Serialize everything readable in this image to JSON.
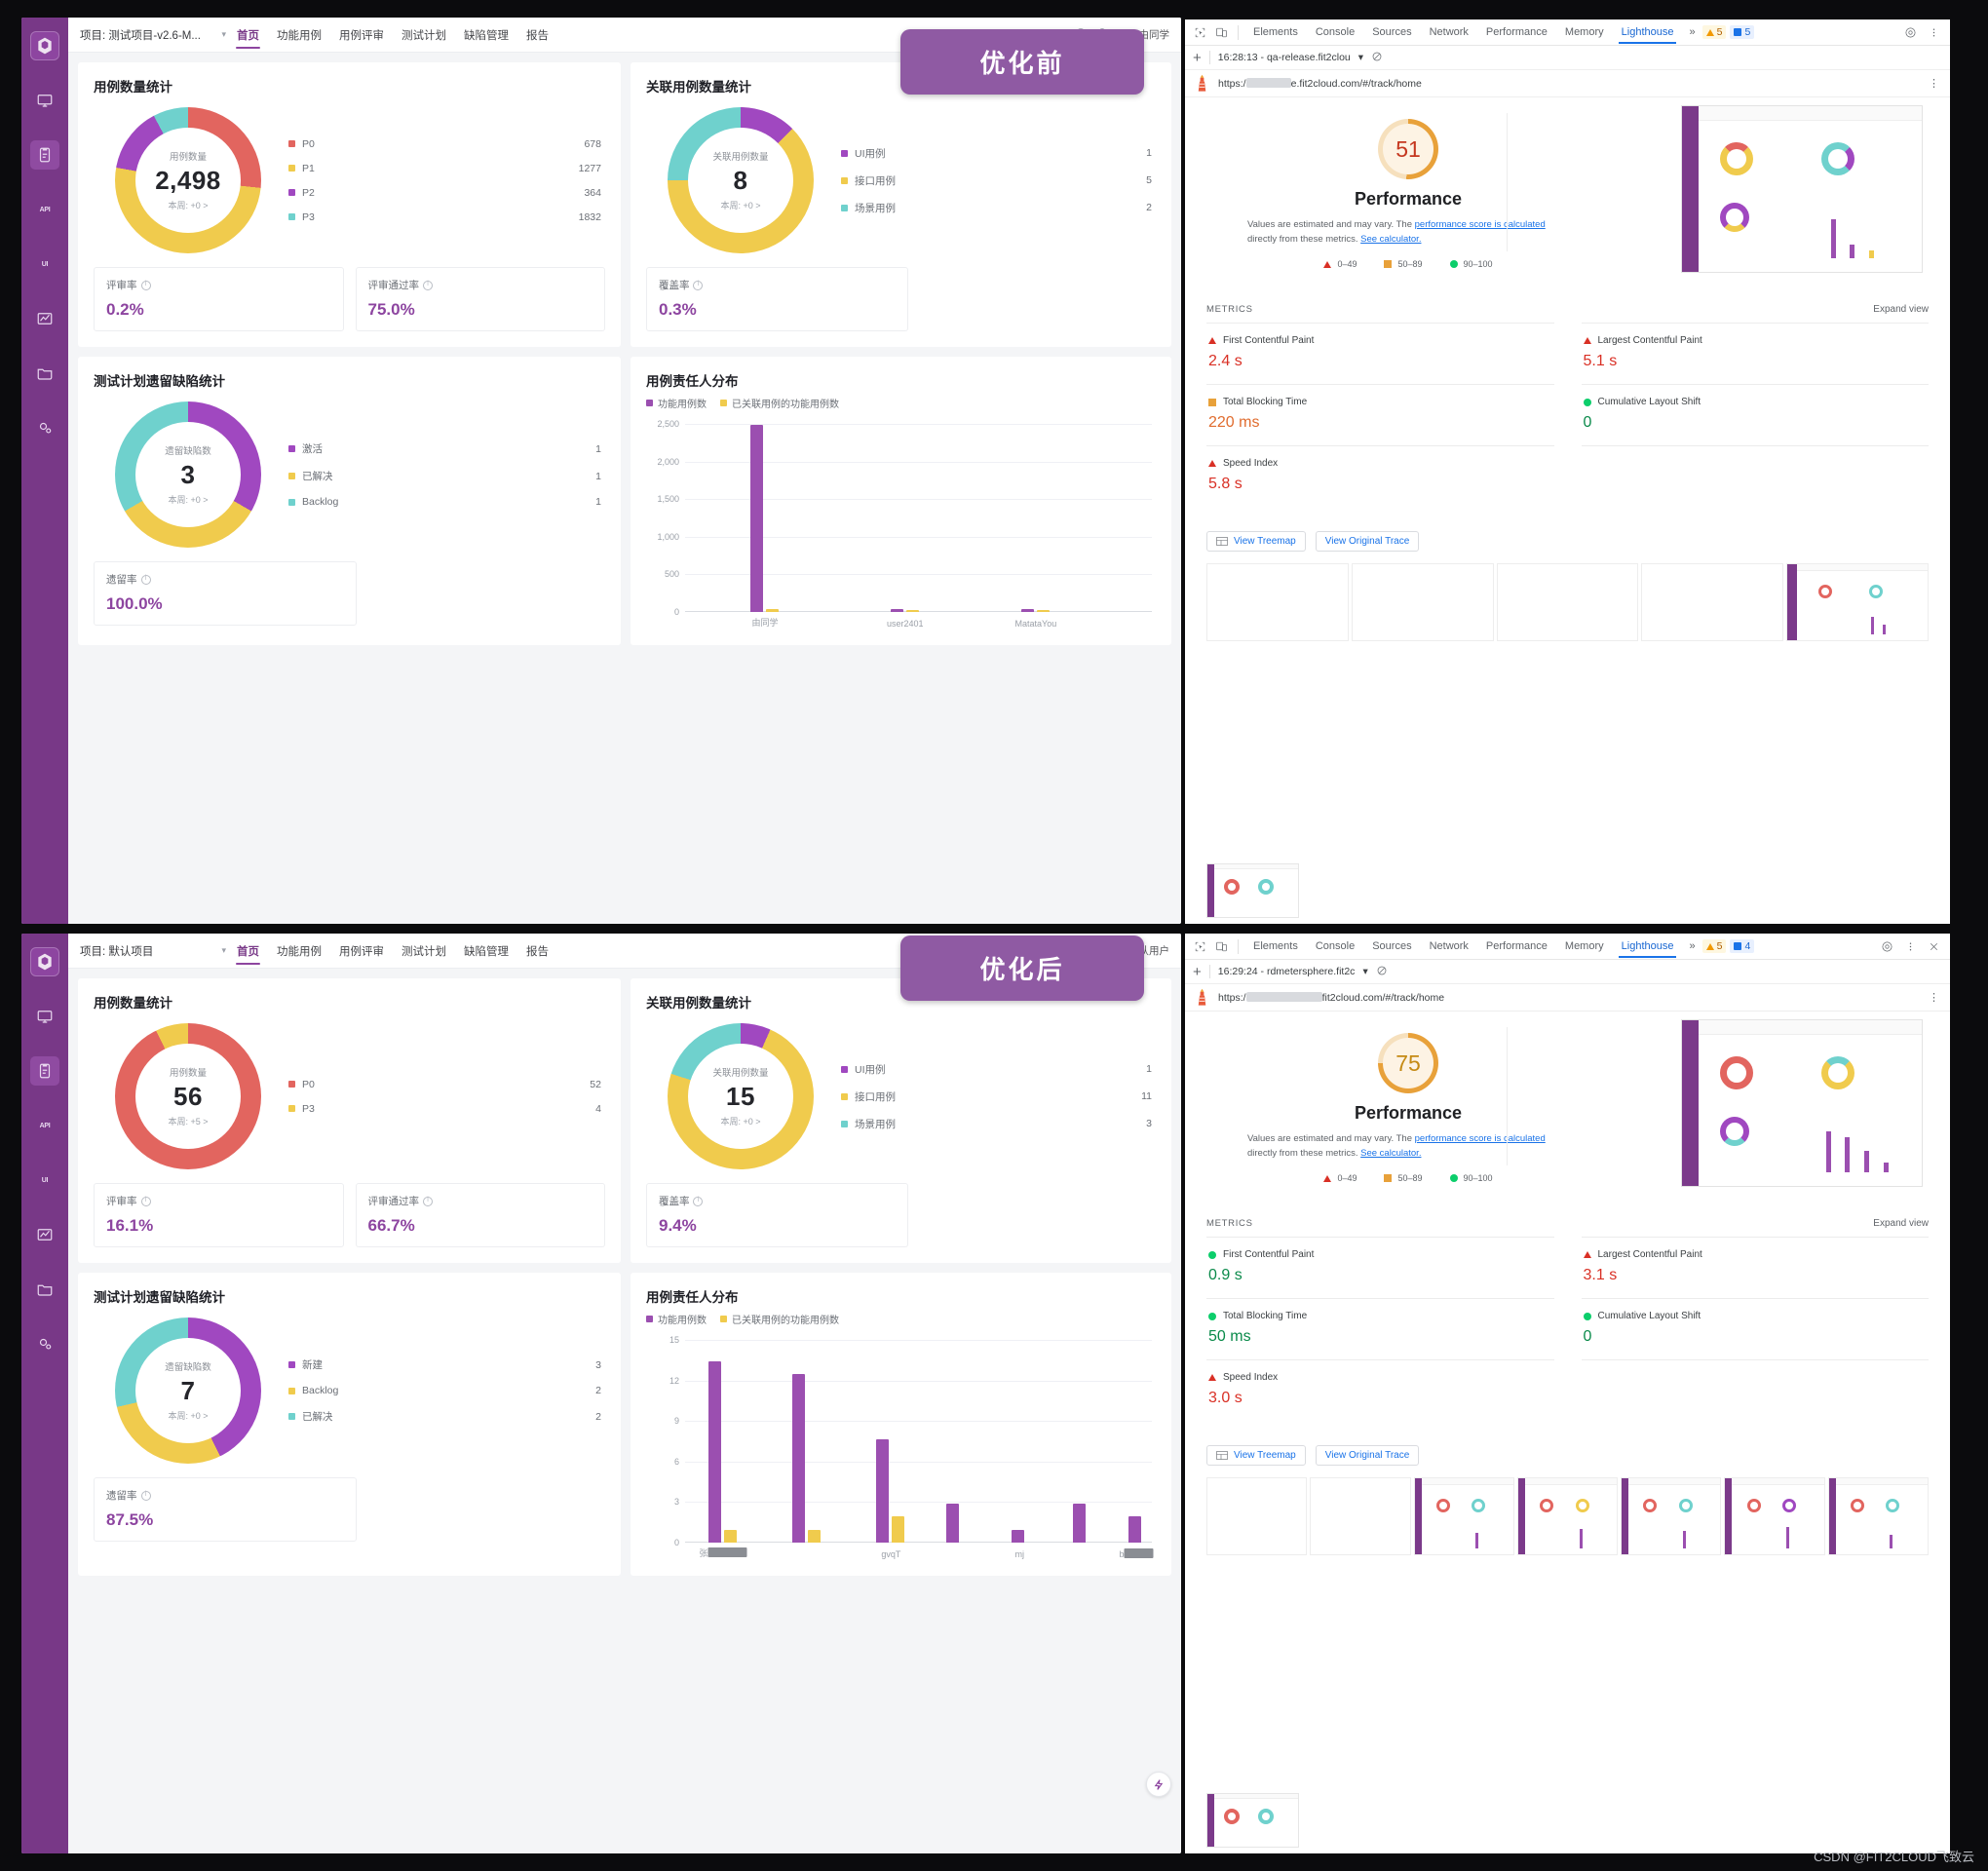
{
  "overlay": {
    "tag_before": "优化前",
    "tag_after": "优化后",
    "watermark": "CSDN @FIT2CLOUD飞致云"
  },
  "app_top": {
    "project_selector": "项目: 测试项目-v2.6-M...",
    "nav": [
      "首页",
      "功能用例",
      "用例评审",
      "测试计划",
      "缺陷管理",
      "报告"
    ],
    "active_nav": "首页",
    "user": "由同学",
    "cards": {
      "case_count": {
        "title": "用例数量统计",
        "center_label": "用例数量",
        "center_value": "2,498",
        "center_sub": "本周: +0 >",
        "legend": [
          {
            "label": "P0",
            "value": "678",
            "color": "#e2655f"
          },
          {
            "label": "P1",
            "value": "1277",
            "color": "#f0cb4d"
          },
          {
            "label": "P2",
            "value": "364",
            "color": "#a048c0"
          },
          {
            "label": "P3",
            "value": "1832",
            "color": "#6fd1cd"
          }
        ],
        "stats": [
          {
            "label": "评审率",
            "value": "0.2%"
          },
          {
            "label": "评审通过率",
            "value": "75.0%"
          }
        ]
      },
      "linked_case_count": {
        "title": "关联用例数量统计",
        "center_label": "关联用例数量",
        "center_value": "8",
        "center_sub": "本周: +0 >",
        "legend": [
          {
            "label": "UI用例",
            "value": "1",
            "color": "#a048c0"
          },
          {
            "label": "接口用例",
            "value": "5",
            "color": "#f0cb4d"
          },
          {
            "label": "场景用例",
            "value": "2",
            "color": "#6fd1cd"
          }
        ],
        "stats": [
          {
            "label": "覆盖率",
            "value": "0.3%"
          }
        ]
      },
      "plan_defects": {
        "title": "测试计划遗留缺陷统计",
        "center_label": "遗留缺陷数",
        "center_value": "3",
        "center_sub": "本周: +0 >",
        "legend": [
          {
            "label": "激活",
            "value": "1",
            "color": "#a048c0"
          },
          {
            "label": "已解决",
            "value": "1",
            "color": "#f0cb4d"
          },
          {
            "label": "Backlog",
            "value": "1",
            "color": "#6fd1cd"
          }
        ],
        "stats": [
          {
            "label": "遗留率",
            "value": "100.0%"
          }
        ]
      },
      "owner_dist": {
        "title": "用例责任人分布",
        "legend": [
          {
            "label": "功能用例数",
            "color": "#9b4fb0"
          },
          {
            "label": "已关联用例的功能用例数",
            "color": "#f0cb4d"
          }
        ]
      }
    }
  },
  "app_bottom": {
    "project_selector": "项目: 默认项目",
    "nav": [
      "首页",
      "功能用例",
      "用例评审",
      "测试计划",
      "缺陷管理",
      "报告"
    ],
    "active_nav": "首页",
    "user": "默认用户",
    "cards": {
      "case_count": {
        "title": "用例数量统计",
        "center_label": "用例数量",
        "center_value": "56",
        "center_sub": "本周: +5 >",
        "legend": [
          {
            "label": "P0",
            "value": "52",
            "color": "#e2655f"
          },
          {
            "label": "P3",
            "value": "4",
            "color": "#f0cb4d"
          }
        ],
        "stats": [
          {
            "label": "评审率",
            "value": "16.1%"
          },
          {
            "label": "评审通过率",
            "value": "66.7%"
          }
        ]
      },
      "linked_case_count": {
        "title": "关联用例数量统计",
        "center_label": "关联用例数量",
        "center_value": "15",
        "center_sub": "本周: +0 >",
        "legend": [
          {
            "label": "UI用例",
            "value": "1",
            "color": "#a048c0"
          },
          {
            "label": "接口用例",
            "value": "11",
            "color": "#f0cb4d"
          },
          {
            "label": "场景用例",
            "value": "3",
            "color": "#6fd1cd"
          }
        ],
        "stats": [
          {
            "label": "覆盖率",
            "value": "9.4%"
          }
        ]
      },
      "plan_defects": {
        "title": "测试计划遗留缺陷统计",
        "center_label": "遗留缺陷数",
        "center_value": "7",
        "center_sub": "本周: +0 >",
        "legend": [
          {
            "label": "新建",
            "value": "3",
            "color": "#a048c0"
          },
          {
            "label": "Backlog",
            "value": "2",
            "color": "#f0cb4d"
          },
          {
            "label": "已解决",
            "value": "2",
            "color": "#6fd1cd"
          }
        ],
        "stats": [
          {
            "label": "遗留率",
            "value": "87.5%"
          }
        ]
      },
      "owner_dist": {
        "title": "用例责任人分布",
        "legend": [
          {
            "label": "功能用例数",
            "color": "#9b4fb0"
          },
          {
            "label": "已关联用例的功能用例数",
            "color": "#f0cb4d"
          }
        ]
      }
    }
  },
  "devtools_top": {
    "tabs": [
      "Elements",
      "Console",
      "Sources",
      "Network",
      "Performance",
      "Memory",
      "Lighthouse"
    ],
    "active_tab": "Lighthouse",
    "overflow": "»",
    "warn_count": "5",
    "info_count": "5",
    "run_timestamp": "16:28:13 - qa-release.fit2clou",
    "url": "https://□□□□□e.fit2cloud.com/#/track/home"
  },
  "devtools_bottom": {
    "tabs": [
      "Elements",
      "Console",
      "Sources",
      "Network",
      "Performance",
      "Memory",
      "Lighthouse"
    ],
    "active_tab": "Lighthouse",
    "overflow": "»",
    "warn_count": "5",
    "info_count": "4",
    "run_timestamp": "16:29:24 - rdmetersphere.fit2c",
    "url": "https://□□□□□□fit2cloud.com/#/track/home"
  },
  "lighthouse_top": {
    "score": "51",
    "score_color": "#c5371f",
    "gauge_color": "#e8a13a",
    "gauge_bg": "#fdf3e4",
    "category": "Performance",
    "note_1": "Values are estimated and may vary. The ",
    "note_link_1": "performance score is calculated",
    "note_2": " directly from these metrics. ",
    "note_link_2": "See calculator.",
    "scale": [
      "0–49",
      "50–89",
      "90–100"
    ],
    "metrics_header": "METRICS",
    "expand_view": "Expand view",
    "metrics": [
      {
        "label": "First Contentful Paint",
        "value": "2.4 s",
        "status": "bad"
      },
      {
        "label": "Largest Contentful Paint",
        "value": "5.1 s",
        "status": "bad"
      },
      {
        "label": "Total Blocking Time",
        "value": "220 ms",
        "status": "avg"
      },
      {
        "label": "Cumulative Layout Shift",
        "value": "0",
        "status": "good"
      },
      {
        "label": "Speed Index",
        "value": "5.8 s",
        "status": "bad"
      }
    ],
    "buttons": [
      "View Treemap",
      "View Original Trace"
    ]
  },
  "lighthouse_bottom": {
    "score": "75",
    "score_color": "#c58a14",
    "gauge_color": "#e8a13a",
    "gauge_bg": "#fdf3e4",
    "category": "Performance",
    "note_1": "Values are estimated and may vary. The ",
    "note_link_1": "performance score is calculated",
    "note_2": " directly from these metrics. ",
    "note_link_2": "See calculator.",
    "scale": [
      "0–49",
      "50–89",
      "90–100"
    ],
    "metrics_header": "METRICS",
    "expand_view": "Expand view",
    "metrics": [
      {
        "label": "First Contentful Paint",
        "value": "0.9 s",
        "status": "good"
      },
      {
        "label": "Largest Contentful Paint",
        "value": "3.1 s",
        "status": "bad"
      },
      {
        "label": "Total Blocking Time",
        "value": "50 ms",
        "status": "good"
      },
      {
        "label": "Cumulative Layout Shift",
        "value": "0",
        "status": "good"
      },
      {
        "label": "Speed Index",
        "value": "3.0 s",
        "status": "bad"
      }
    ],
    "buttons": [
      "View Treemap",
      "View Original Trace"
    ]
  },
  "chart_data": [
    {
      "id": "top_case_count_donut",
      "type": "pie",
      "title": "用例数量统计",
      "categories": [
        "P0",
        "P1",
        "P2",
        "P3"
      ],
      "values": [
        678,
        1277,
        364,
        1832
      ],
      "colors": [
        "#e2655f",
        "#f0cb4d",
        "#a048c0",
        "#6fd1cd"
      ],
      "center_total": 2498,
      "legend": "right"
    },
    {
      "id": "top_linked_donut",
      "type": "pie",
      "title": "关联用例数量统计",
      "categories": [
        "UI用例",
        "接口用例",
        "场景用例"
      ],
      "values": [
        1,
        5,
        2
      ],
      "colors": [
        "#a048c0",
        "#f0cb4d",
        "#6fd1cd"
      ],
      "center_total": 8,
      "legend": "right"
    },
    {
      "id": "top_plan_defect_donut",
      "type": "pie",
      "title": "测试计划遗留缺陷统计",
      "categories": [
        "激活",
        "已解决",
        "Backlog"
      ],
      "values": [
        1,
        1,
        1
      ],
      "colors": [
        "#a048c0",
        "#f0cb4d",
        "#6fd1cd"
      ],
      "center_total": 3,
      "legend": "right"
    },
    {
      "id": "top_owner_bar",
      "type": "bar",
      "title": "用例责任人分布",
      "categories": [
        "由同学",
        "user2401",
        "MatataYou"
      ],
      "series": [
        {
          "name": "功能用例数",
          "values": [
            2490,
            25,
            20
          ],
          "color": "#9b4fb0"
        },
        {
          "name": "已关联用例的功能用例数",
          "values": [
            30,
            8,
            6
          ],
          "color": "#f0cb4d"
        }
      ],
      "yticks": [
        "0",
        "500",
        "1,000",
        "1,500",
        "2,000",
        "2,500"
      ],
      "ylim": [
        0,
        2500
      ],
      "grid": true,
      "legend": "top"
    },
    {
      "id": "bottom_case_count_donut",
      "type": "pie",
      "title": "用例数量统计",
      "categories": [
        "P0",
        "P3"
      ],
      "values": [
        52,
        4
      ],
      "colors": [
        "#e2655f",
        "#f0cb4d"
      ],
      "center_total": 56,
      "legend": "right"
    },
    {
      "id": "bottom_linked_donut",
      "type": "pie",
      "title": "关联用例数量统计",
      "categories": [
        "UI用例",
        "接口用例",
        "场景用例"
      ],
      "values": [
        1,
        11,
        3
      ],
      "colors": [
        "#a048c0",
        "#f0cb4d",
        "#6fd1cd"
      ],
      "center_total": 15,
      "legend": "right"
    },
    {
      "id": "bottom_plan_defect_donut",
      "type": "pie",
      "title": "测试计划遗留缺陷统计",
      "categories": [
        "新建",
        "Backlog",
        "已解决"
      ],
      "values": [
        3,
        2,
        2
      ],
      "colors": [
        "#a048c0",
        "#f0cb4d",
        "#6fd1cd"
      ],
      "center_total": 7,
      "legend": "right"
    },
    {
      "id": "bottom_owner_bar",
      "type": "bar",
      "title": "用例责任人分布",
      "categories": [
        "张█████",
        "gvqT",
        "mj",
        "b█████"
      ],
      "series": [
        {
          "name": "功能用例数",
          "values": [
            14,
            13,
            8,
            3,
            0,
            3,
            2
          ],
          "color": "#9b4fb0"
        },
        {
          "name": "已关联用例的功能用例数",
          "values": [
            1,
            1,
            2,
            0,
            0,
            0,
            1
          ],
          "color": "#f0cb4d"
        }
      ],
      "yticks": [
        "0",
        "3",
        "6",
        "9",
        "12",
        "15"
      ],
      "ylim": [
        0,
        15
      ],
      "grid": true,
      "legend": "top"
    }
  ]
}
